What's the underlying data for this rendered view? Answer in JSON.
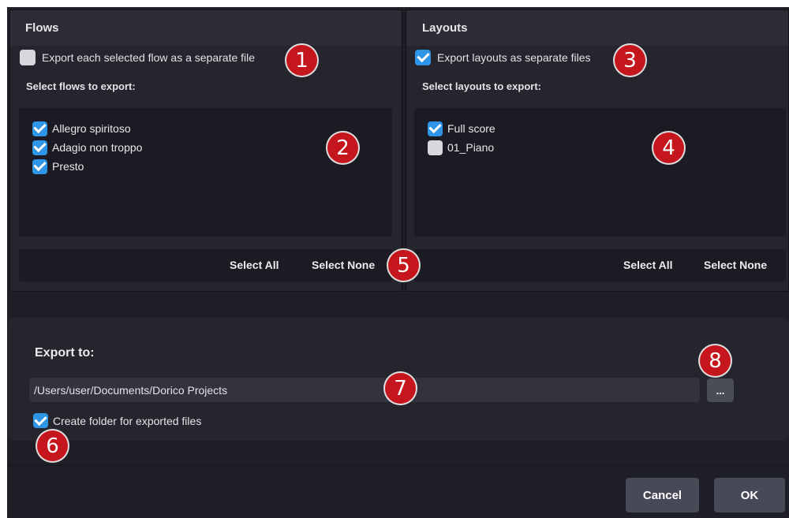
{
  "flows": {
    "title": "Flows",
    "separate_label": "Export each selected flow as a separate file",
    "separate_checked": false,
    "select_label": "Select flows to export:",
    "items": [
      {
        "label": "Allegro spiritoso",
        "checked": true
      },
      {
        "label": "Adagio non troppo",
        "checked": true
      },
      {
        "label": "Presto",
        "checked": true
      }
    ],
    "select_all": "Select All",
    "select_none": "Select None"
  },
  "layouts": {
    "title": "Layouts",
    "separate_label": "Export layouts as separate files",
    "separate_checked": true,
    "select_label": "Select layouts to export:",
    "items": [
      {
        "label": "Full score",
        "checked": true
      },
      {
        "label": "01_Piano",
        "checked": false
      }
    ],
    "select_all": "Select All",
    "select_none": "Select None"
  },
  "export": {
    "title": "Export to:",
    "path": "/Users/user/Documents/Dorico Projects",
    "browse_label": "...",
    "create_folder_label": "Create folder for exported files",
    "create_folder_checked": true
  },
  "dialog": {
    "cancel": "Cancel",
    "ok": "OK"
  },
  "callouts": [
    "1",
    "2",
    "3",
    "4",
    "5",
    "6",
    "7",
    "8"
  ],
  "colors": {
    "accent": "#2f95e6",
    "callout": "#c5161d",
    "background": "#1e1f26"
  }
}
